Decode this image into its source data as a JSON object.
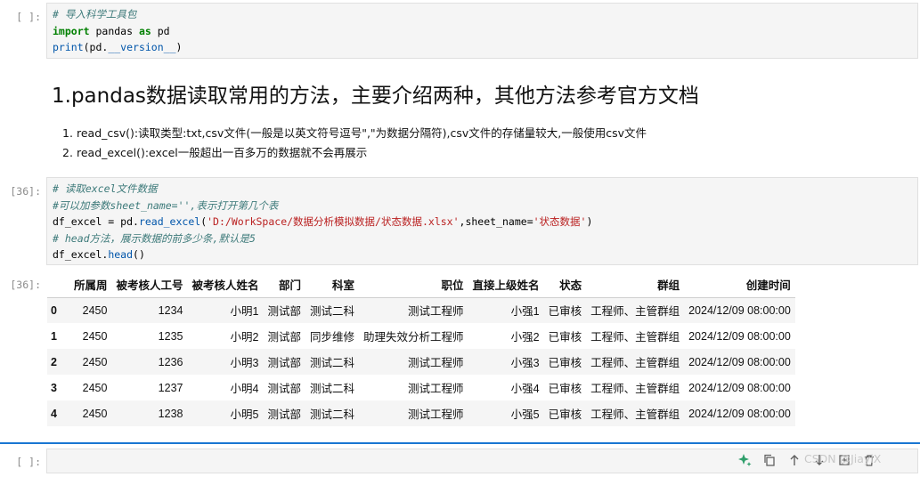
{
  "cells": {
    "cell1": {
      "prompt": "[ ]:",
      "lines": [
        [
          {
            "t": "# 导入科学工具包",
            "c": "cmt"
          }
        ],
        [
          {
            "t": "import",
            "c": "kw"
          },
          {
            "t": " pandas ",
            "c": ""
          },
          {
            "t": "as",
            "c": "kw"
          },
          {
            "t": " pd",
            "c": ""
          }
        ],
        [
          {
            "t": "print",
            "c": "fn"
          },
          {
            "t": "(pd.",
            "c": ""
          },
          {
            "t": "__version__",
            "c": "fn"
          },
          {
            "t": ")",
            "c": ""
          }
        ]
      ]
    },
    "markdown": {
      "heading": "1.pandas数据读取常用的方法，主要介绍两种，其他方法参考官方文档",
      "items": [
        "read_csv():读取类型:txt,csv文件(一般是以英文符号逗号\",\"为数据分隔符),csv文件的存储量较大,一般使用csv文件",
        "read_excel():excel一般超出一百多万的数据就不会再展示"
      ]
    },
    "cell2": {
      "prompt": "[36]:",
      "lines": [
        [
          {
            "t": "# 读取excel文件数据",
            "c": "cmt"
          }
        ],
        [
          {
            "t": "#可以加参数sheet_name='',表示打开第几个表",
            "c": "cmt"
          }
        ],
        [
          {
            "t": "df_excel = pd.",
            "c": ""
          },
          {
            "t": "read_excel",
            "c": "fn"
          },
          {
            "t": "(",
            "c": ""
          },
          {
            "t": "'D:/WorkSpace/数据分析模拟数据/状态数据.xlsx'",
            "c": "str"
          },
          {
            "t": ",sheet_name=",
            "c": ""
          },
          {
            "t": "'状态数据'",
            "c": "str"
          },
          {
            "t": ")",
            "c": ""
          }
        ],
        [
          {
            "t": "# head方法，展示数据的前多少条,默认是5",
            "c": "cmt"
          }
        ],
        [
          {
            "t": "df_excel.",
            "c": ""
          },
          {
            "t": "head",
            "c": "fn"
          },
          {
            "t": "()",
            "c": ""
          }
        ]
      ]
    },
    "output": {
      "prompt": "[36]:",
      "columns": [
        "",
        "所属周",
        "被考核人工号",
        "被考核人姓名",
        "部门",
        "科室",
        "职位",
        "直接上级姓名",
        "状态",
        "群组",
        "创建时间"
      ],
      "rows": [
        [
          "0",
          "2450",
          "1234",
          "小明1",
          "测试部",
          "测试二科",
          "测试工程师",
          "小强1",
          "已审核",
          "工程师、主管群组",
          "2024/12/09 08:00:00"
        ],
        [
          "1",
          "2450",
          "1235",
          "小明2",
          "测试部",
          "同步维修",
          "助理失效分析工程师",
          "小强2",
          "已审核",
          "工程师、主管群组",
          "2024/12/09 08:00:00"
        ],
        [
          "2",
          "2450",
          "1236",
          "小明3",
          "测试部",
          "测试二科",
          "测试工程师",
          "小强3",
          "已审核",
          "工程师、主管群组",
          "2024/12/09 08:00:00"
        ],
        [
          "3",
          "2450",
          "1237",
          "小明4",
          "测试部",
          "测试二科",
          "测试工程师",
          "小强4",
          "已审核",
          "工程师、主管群组",
          "2024/12/09 08:00:00"
        ],
        [
          "4",
          "2450",
          "1238",
          "小明5",
          "测试部",
          "测试二科",
          "测试工程师",
          "小强5",
          "已审核",
          "工程师、主管群组",
          "2024/12/09 08:00:00"
        ]
      ]
    },
    "cell3": {
      "prompt": "[ ]:",
      "value": ""
    }
  },
  "toolbar": {
    "icons": [
      "sparkle-icon",
      "copy-icon",
      "move-up-icon",
      "move-down-icon",
      "insert-icon",
      "delete-icon"
    ]
  },
  "watermark": "CSDN @JiayiX"
}
